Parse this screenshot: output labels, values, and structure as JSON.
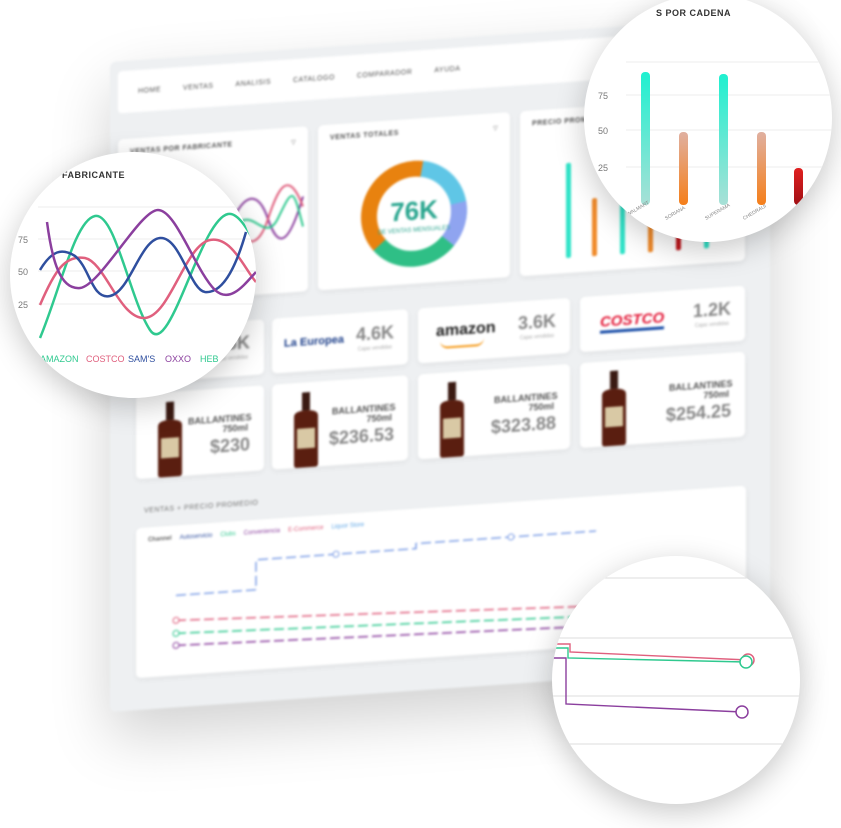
{
  "nav": {
    "items": [
      "HOME",
      "VENTAS",
      "ANALISIS",
      "CATALOGO",
      "COMPARADOR",
      "AYUDA"
    ]
  },
  "cards": {
    "fabricante_title": "VENTAS POR FABRICANTE",
    "donut_title": "VENTAS TOTALES",
    "donut_value": "76K",
    "donut_sub": "DE VENTAS MENSUALES",
    "cadena_title": "PRECIO PROMEDIO POR CADENA"
  },
  "stores": [
    {
      "name": "",
      "value": "4.6K",
      "sub": "Cajas vendidas"
    },
    {
      "name": "La Europea",
      "value": "4.6K",
      "sub": "Cajas vendidas"
    },
    {
      "name": "amazon",
      "value": "3.6K",
      "sub": "Cajas vendidas"
    },
    {
      "name": "COSTCO",
      "value": "1.2K",
      "sub": "Cajas vendidas"
    }
  ],
  "products": [
    {
      "name": "BALLANTINES 750ml",
      "price": "$230"
    },
    {
      "name": "BALLANTINES 750ml",
      "price": "$236.53"
    },
    {
      "name": "BALLANTINES 750ml",
      "price": "$323.88"
    },
    {
      "name": "BALLANTINES 750ml",
      "price": "$254.25"
    }
  ],
  "trend": {
    "section_label": "VENTAS + PRECIO PROMEDIO",
    "legend_title": "Channel",
    "legend": [
      "Autoservicio",
      "Clubs",
      "Conveniencia",
      "E-Commerce",
      "Liquor Store"
    ]
  },
  "lens_left": {
    "title": "FABRICANTE",
    "y_ticks": [
      "75",
      "50",
      "25"
    ],
    "legend": [
      {
        "label": "AMAZON",
        "color": "#2fc98f"
      },
      {
        "label": "COSTCO",
        "color": "#e0607e"
      },
      {
        "label": "SAM'S",
        "color": "#2f4f9f"
      },
      {
        "label": "OXXO",
        "color": "#8b3f9e"
      },
      {
        "label": "HEB",
        "color": "#2fc98f"
      }
    ]
  },
  "lens_right": {
    "title": "S POR CADENA",
    "y_ticks": [
      "75",
      "50",
      "25"
    ],
    "x_labels": [
      "WALMART",
      "SORIANA",
      "SUPERAMA",
      "CHEDRAUI",
      ""
    ]
  },
  "colors": {
    "teal": "#2fe3c8",
    "orange": "#f08a2a",
    "red": "#c0151b",
    "green": "#1fbf7f",
    "pink": "#e0607e",
    "purple": "#8b3f9e",
    "navy": "#2f4f9f"
  }
}
